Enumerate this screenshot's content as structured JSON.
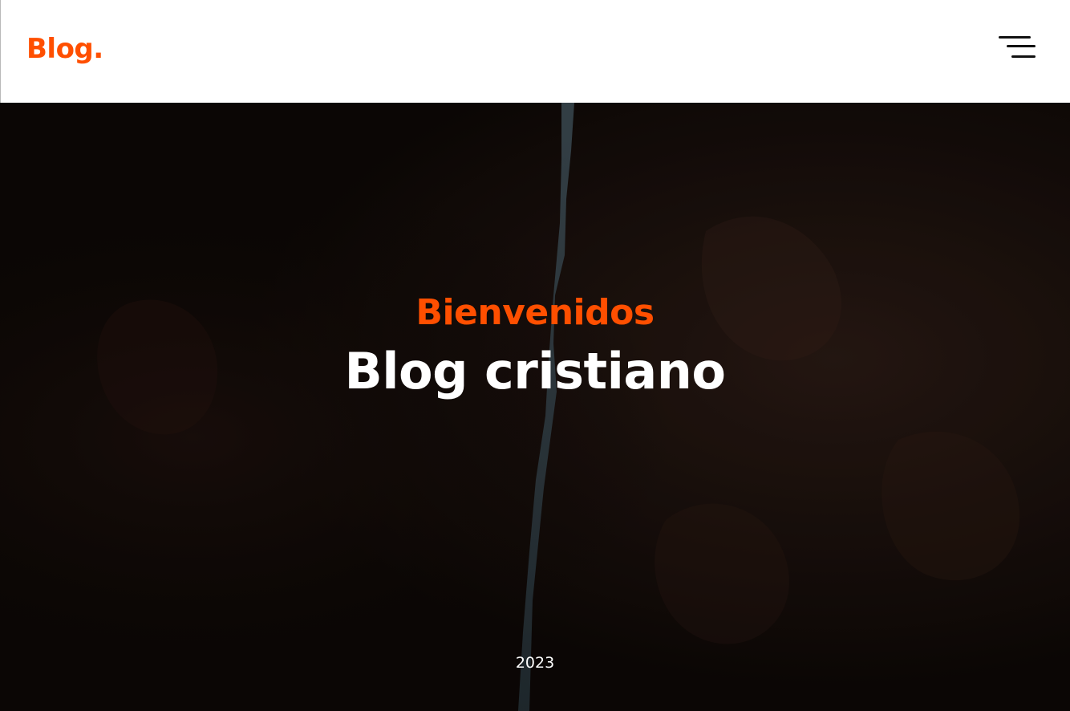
{
  "header": {
    "logo_text": "Blog.",
    "menu_icon": "hamburger-menu-icon"
  },
  "hero": {
    "kicker": "Bienvenidos",
    "title": "Blog cristiano",
    "year": "2023",
    "background": "dark canyon rock photo"
  },
  "colors": {
    "accent": "#ff4f00",
    "header_bg": "#ffffff",
    "hero_text": "#ffffff",
    "hero_bg": "#0f0907"
  }
}
